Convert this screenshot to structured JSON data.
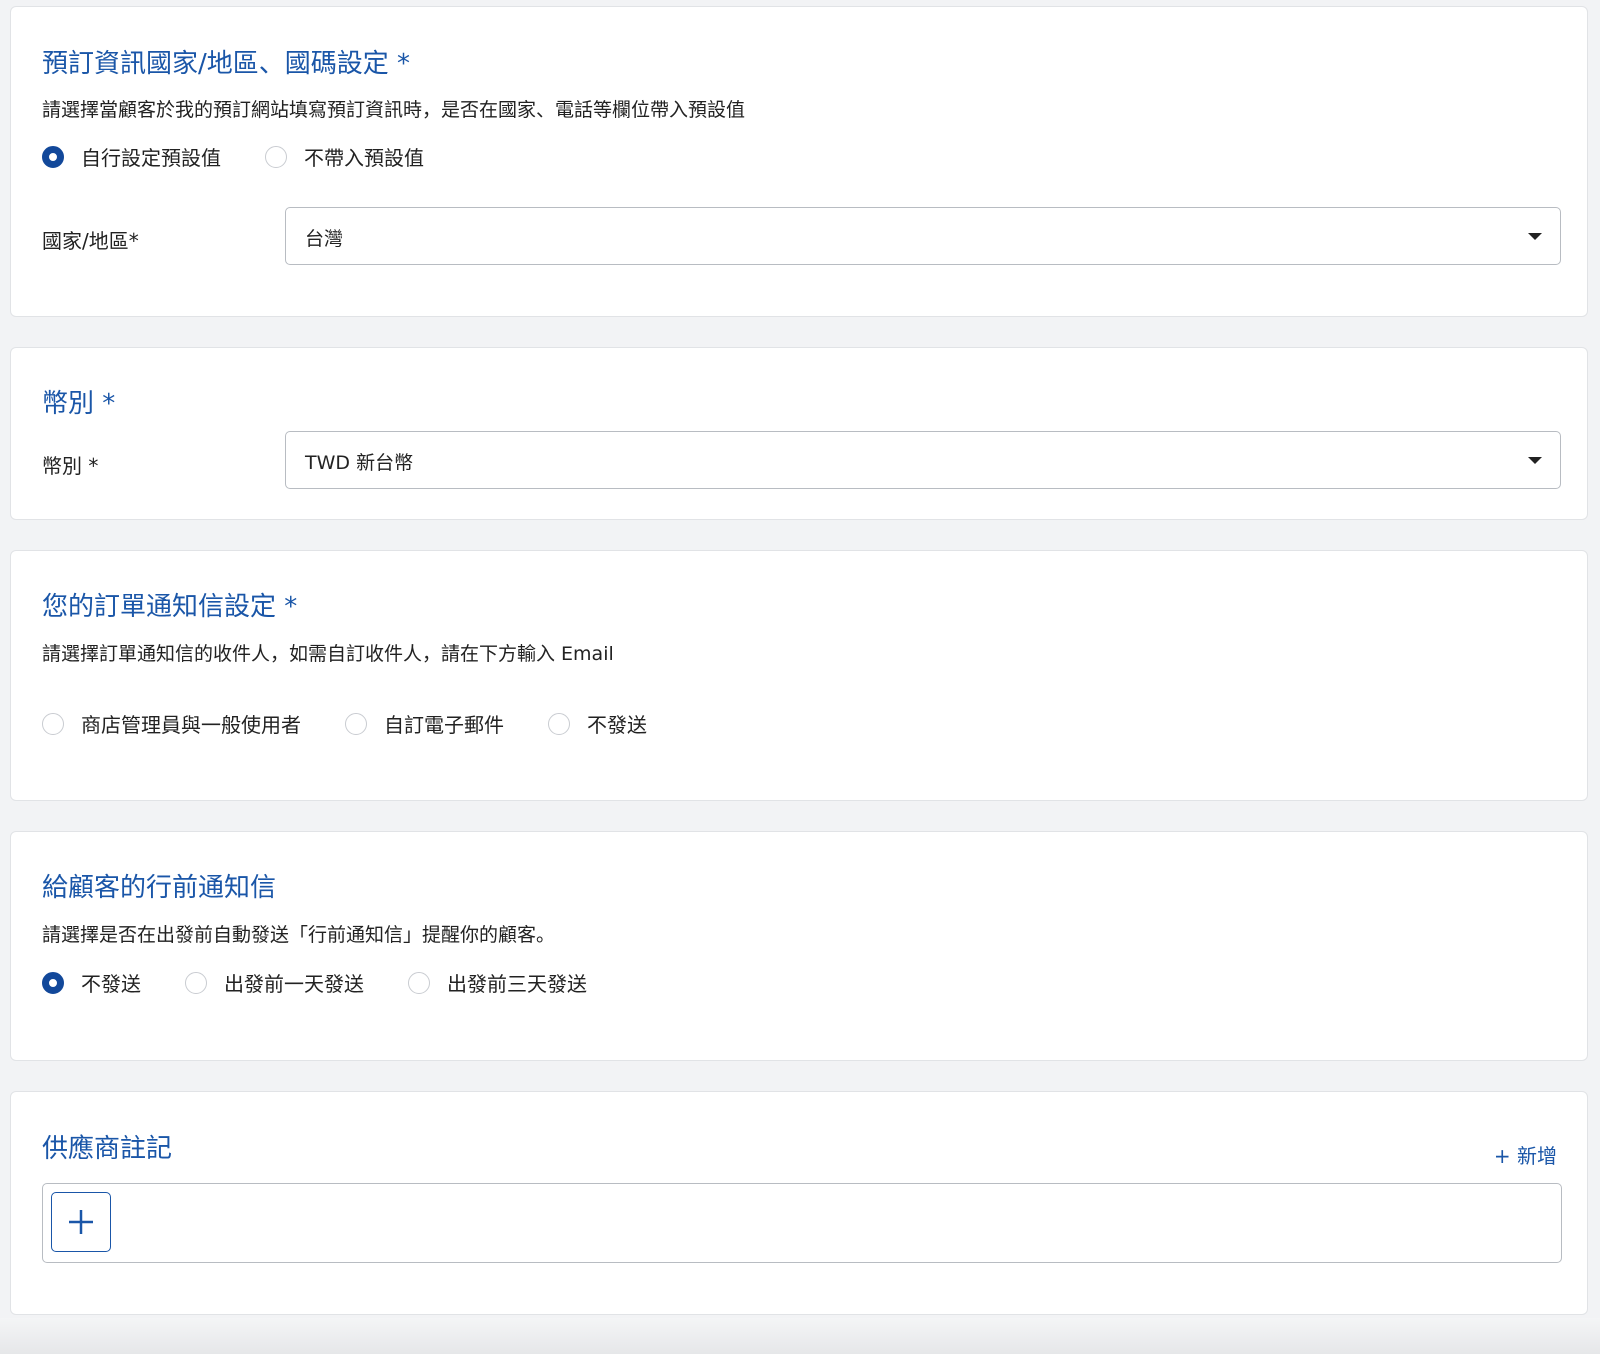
{
  "booking_country": {
    "title": "預訂資訊國家/地區、國碼設定 *",
    "description": "請選擇當顧客於我的預訂網站填寫預訂資訊時，是否在國家、電話等欄位帶入預設值",
    "options": [
      {
        "label": "自行設定預設值",
        "checked": true
      },
      {
        "label": "不帶入預設值",
        "checked": false
      }
    ],
    "field_label": "國家/地區*",
    "selected_value": "台灣"
  },
  "currency": {
    "title": "幣別 *",
    "field_label": "幣別 *",
    "selected_value": "TWD 新台幣"
  },
  "order_notification": {
    "title": "您的訂單通知信設定 *",
    "description": "請選擇訂單通知信的收件人，如需自訂收件人，請在下方輸入 Email",
    "options": [
      {
        "label": "商店管理員與一般使用者",
        "checked": false
      },
      {
        "label": "自訂電子郵件",
        "checked": false
      },
      {
        "label": "不發送",
        "checked": false
      }
    ]
  },
  "pre_trip_notice": {
    "title": "給顧客的行前通知信",
    "description": "請選擇是否在出發前自動發送「行前通知信」提醒你的顧客。",
    "options": [
      {
        "label": "不發送",
        "checked": true
      },
      {
        "label": "出發前一天發送",
        "checked": false
      },
      {
        "label": "出發前三天發送",
        "checked": false
      }
    ]
  },
  "supplier_notes": {
    "title": "供應商註記",
    "add_label": "+ 新增"
  },
  "icons": {
    "dropdown": "caret-down-icon",
    "add": "plus-icon"
  },
  "colors": {
    "accent": "#1a56a8",
    "radio_checked": "#12489a"
  }
}
